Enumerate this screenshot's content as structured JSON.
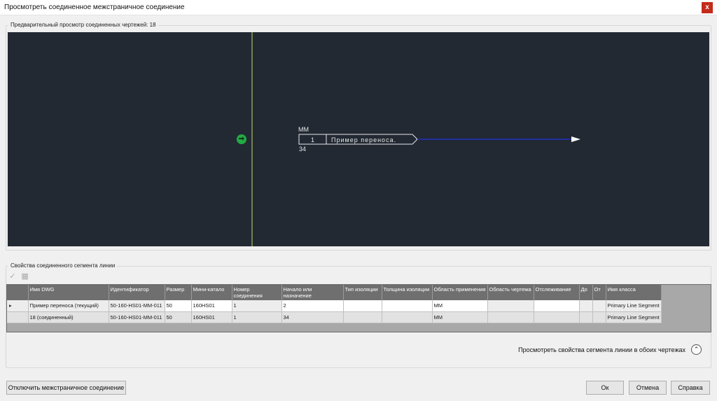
{
  "window": {
    "title": "Просмотреть соединенное межстраничное соединение",
    "close_label": "x"
  },
  "preview": {
    "legend": "Предварительный просмотр соединенных чертежей: 18",
    "tag_top": "MM",
    "tag_number": "1",
    "tag_text": "Пример переноса.",
    "tag_bottom": "34",
    "colors": {
      "background": "#222933",
      "divider": "#c8d66a",
      "flow_line": "#2030c0",
      "node": "#22aa44"
    }
  },
  "segment_props": {
    "legend": "Свойства соединенного сегмента линии",
    "toolbar_icons": [
      "check-icon",
      "edit-icon"
    ],
    "columns": [
      "Имя DWG",
      "Идентификатор",
      "Размер",
      "Мини-катало",
      "Номер соединения",
      "Начало или назначение",
      "Тип изоляции",
      "Толщина изоляции",
      "Область применения",
      "Область чертежа",
      "Отслеживание",
      "До",
      "От",
      "Имя класса"
    ],
    "rows": [
      {
        "marker": "▸",
        "cells": [
          "Пример переноса (текущий)",
          "50-160-HS01-MM-011",
          "50",
          "160HS01",
          "1",
          "2",
          "",
          "",
          "MM",
          "",
          "",
          "",
          "",
          "Primary Line Segment"
        ]
      },
      {
        "marker": "",
        "cells": [
          "18 (соединенный)",
          "50-160-HS01-MM-011",
          "50",
          "160HS01",
          "1",
          "34",
          "",
          "",
          "MM",
          "",
          "",
          "",
          "",
          "Primary Line Segment"
        ]
      }
    ]
  },
  "view_both_label": "Просмотреть свойства сегмента линии в обоих чертежах",
  "buttons": {
    "disconnect": "Отключить межстраничное соединение",
    "ok": "Ок",
    "cancel": "Отмена",
    "help": "Справка"
  }
}
